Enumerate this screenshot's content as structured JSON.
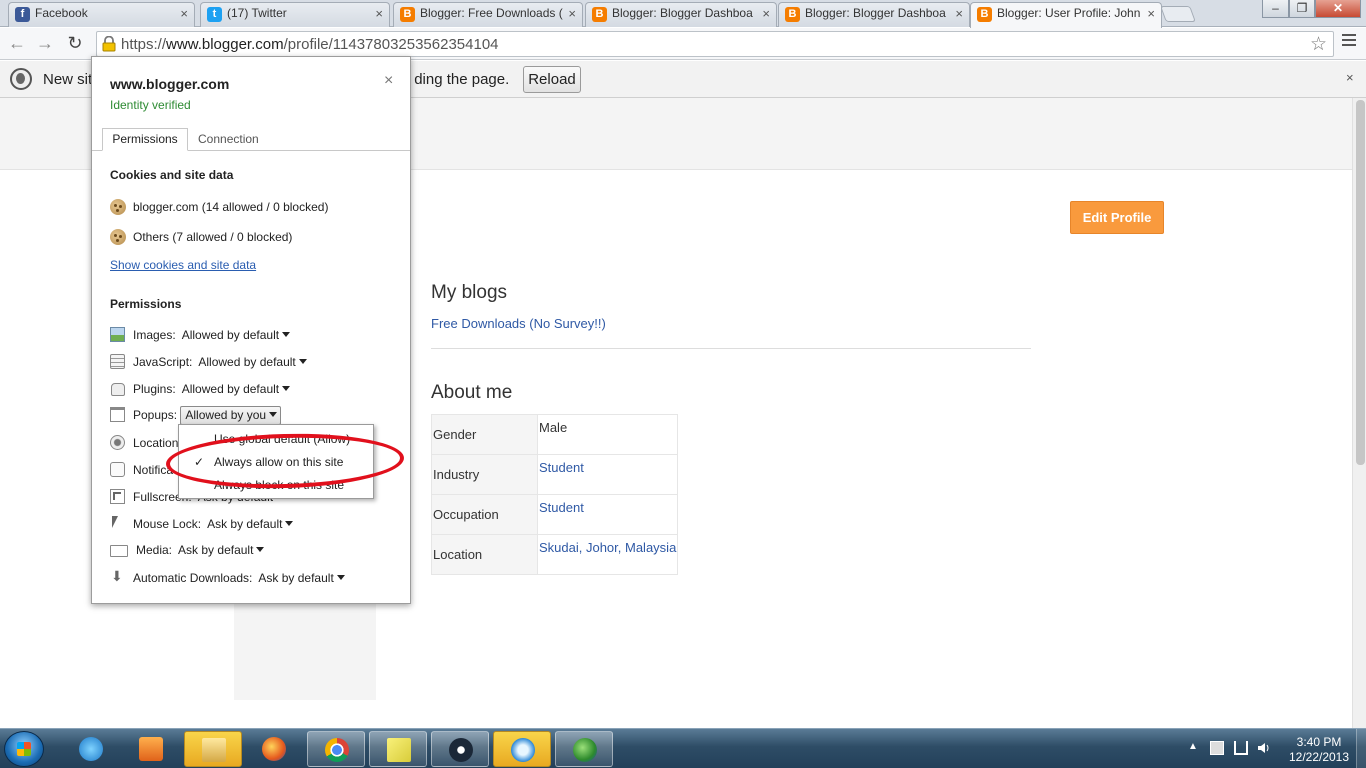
{
  "tabs": [
    {
      "label": "Facebook",
      "favicon": "facebook-icon"
    },
    {
      "label": "(17) Twitter",
      "favicon": "twitter-icon"
    },
    {
      "label": "Blogger: Free Downloads (",
      "favicon": "blogger-icon"
    },
    {
      "label": "Blogger: Blogger Dashboa",
      "favicon": "blogger-icon"
    },
    {
      "label": "Blogger: Blogger Dashboa",
      "favicon": "blogger-icon"
    },
    {
      "label": "Blogger: User Profile: John",
      "favicon": "blogger-icon",
      "active": true
    }
  ],
  "window_controls": {
    "minimize": "–",
    "maximize": "❐",
    "close": "✕"
  },
  "toolbar": {
    "back": "←",
    "forward": "→",
    "reload": "↻",
    "url_scheme": "https://",
    "url_host": "www.blogger.com",
    "url_path": "/profile/11437803253562354104",
    "star": "☆"
  },
  "infobar": {
    "text_left": "New sit",
    "text_right": "ding the page.",
    "reload_label": "Reload",
    "close": "×"
  },
  "page": {
    "edit_profile_label": "Edit Profile",
    "my_blogs_title": "My blogs",
    "blog_link": "Free Downloads (No Survey!!)",
    "about_title": "About me",
    "about_rows": [
      {
        "key": "Gender",
        "value": "Male",
        "link": false
      },
      {
        "key": "Industry",
        "value": "Student",
        "link": true
      },
      {
        "key": "Occupation",
        "value": "Student",
        "link": true
      },
      {
        "key": "Location",
        "value": "Skudai, Johor, Malaysia",
        "link": true
      }
    ],
    "brand_color": "#f99a3d",
    "link_color": "#2f59a5"
  },
  "popup": {
    "host": "www.blogger.com",
    "identity": "Identity verified",
    "close": "×",
    "tab_permissions": "Permissions",
    "tab_connection": "Connection",
    "cookies_title": "Cookies and site data",
    "cookie_rows": [
      "blogger.com (14 allowed / 0 blocked)",
      "Others (7 allowed / 0 blocked)"
    ],
    "show_cookies_link": "Show cookies and site data",
    "permissions_title": "Permissions",
    "permissions": [
      {
        "label": "Images:",
        "value": "Allowed by default",
        "icon": "image-icon"
      },
      {
        "label": "JavaScript:",
        "value": "Allowed by default",
        "icon": "javascript-icon"
      },
      {
        "label": "Plugins:",
        "value": "Allowed by default",
        "icon": "plugin-icon"
      },
      {
        "label": "Popups:",
        "value": "Allowed by you",
        "icon": "popup-icon"
      },
      {
        "label": "Location",
        "value": "",
        "icon": "location-icon"
      },
      {
        "label": "Notifica",
        "value": "",
        "icon": "notification-icon"
      },
      {
        "label": "Fullscreen:",
        "value": "Ask by default",
        "icon": "fullscreen-icon"
      },
      {
        "label": "Mouse Lock:",
        "value": "Ask by default",
        "icon": "mouse-lock-icon"
      },
      {
        "label": "Media:",
        "value": "Ask by default",
        "icon": "media-icon"
      },
      {
        "label": "Automatic Downloads:",
        "value": "Ask by default",
        "icon": "download-icon"
      }
    ],
    "popups_menu": [
      {
        "label": "Use global default (Allow)",
        "checked": false
      },
      {
        "label": "Always allow on this site",
        "checked": true
      },
      {
        "label": "Always block on this site",
        "checked": false
      }
    ],
    "check_mark": "✓",
    "identity_color": "#2e8b33",
    "annotation_color": "#e1101c"
  },
  "taskbar": {
    "apps": [
      "internet-explorer-icon",
      "media-player-icon",
      "file-explorer-icon",
      "firefox-icon",
      "chrome-icon",
      "sticky-notes-icon",
      "steam-icon",
      "speedometer-icon",
      "network-globe-icon"
    ],
    "time": "3:40 PM",
    "date": "12/22/2013",
    "tray_arrow": "▲"
  }
}
